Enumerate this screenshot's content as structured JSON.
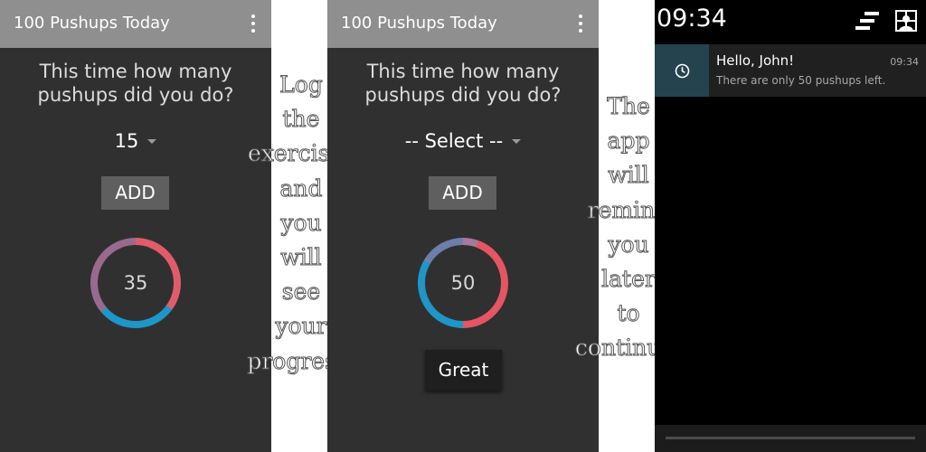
{
  "screens": [
    {
      "appbar_title": "100 Pushups Today",
      "question_line1": "This time how many",
      "question_line2": "pushups did you do?",
      "spinner_value": "15",
      "add_label": "ADD",
      "progress_value": "35",
      "ring_colors": [
        "#e15c6a",
        "#1e96c8",
        "#9a6a8e"
      ]
    },
    {
      "appbar_title": "100 Pushups Today",
      "question_line1": "This time how many",
      "question_line2": "pushups did you do?",
      "spinner_value": "-- Select --",
      "add_label": "ADD",
      "progress_value": "50",
      "great_label": "Great",
      "ring_colors": [
        "#e55564",
        "#1e96c8",
        "#a67a9a"
      ]
    }
  ],
  "captions": {
    "log": [
      "Log",
      "the",
      "exercises",
      "and",
      "you",
      "will",
      "see",
      "your",
      "progress."
    ],
    "remind": [
      "The",
      "app",
      "will",
      "remind",
      "you",
      "later",
      "to",
      "continue."
    ]
  },
  "notification_screen": {
    "clock": "09:34",
    "notification": {
      "icon": "clock-icon",
      "title": "Hello, John!",
      "body": "There are only 50 pushups left.",
      "time": "09:34"
    },
    "status_icons": [
      "notification-list-icon",
      "quick-settings-user-icon"
    ]
  },
  "colors": {
    "screen_bg": "#303030",
    "appbar": "#8f8f8f",
    "add_button": "#5f5f5f",
    "great_button": "#1f1f1f"
  }
}
